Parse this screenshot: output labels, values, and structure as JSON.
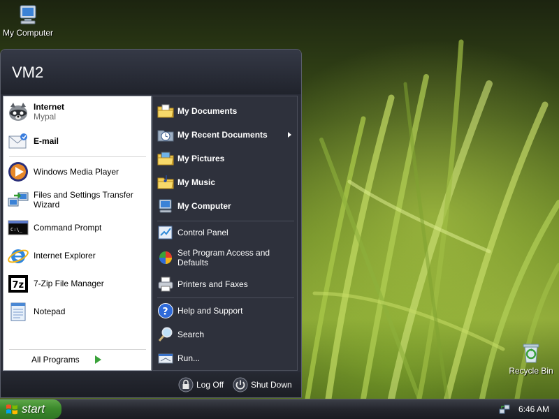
{
  "desktop": {
    "icons": [
      {
        "label": "My Computer",
        "icon": "my-computer-icon"
      },
      {
        "label": "Recycle Bin",
        "icon": "recycle-bin-icon"
      }
    ]
  },
  "start_menu": {
    "user_name": "VM2",
    "pinned": [
      {
        "title": "Internet",
        "subtitle": "Mypal",
        "icon": "raccoon-browser-icon"
      },
      {
        "title": "E-mail",
        "icon": "email-icon"
      }
    ],
    "recent": [
      {
        "label": "Windows Media Player",
        "icon": "media-player-icon"
      },
      {
        "label": "Files and Settings Transfer Wizard",
        "icon": "transfer-wizard-icon"
      },
      {
        "label": "Command Prompt",
        "icon": "command-prompt-icon"
      },
      {
        "label": "Internet Explorer",
        "icon": "internet-explorer-icon"
      },
      {
        "label": "7-Zip File Manager",
        "icon": "seven-zip-icon"
      },
      {
        "label": "Notepad",
        "icon": "notepad-icon"
      }
    ],
    "all_programs": "All Programs",
    "places": [
      {
        "label": "My Documents",
        "icon": "folder-documents-icon"
      },
      {
        "label": "My Recent Documents",
        "icon": "recent-documents-icon"
      },
      {
        "label": "My Pictures",
        "icon": "folder-pictures-icon"
      },
      {
        "label": "My Music",
        "icon": "folder-music-icon"
      },
      {
        "label": "My Computer",
        "icon": "my-computer-icon"
      }
    ],
    "settings": [
      {
        "label": "Control Panel",
        "icon": "control-panel-icon"
      },
      {
        "label": "Set Program Access and Defaults",
        "icon": "program-defaults-icon"
      },
      {
        "label": "Printers and Faxes",
        "icon": "printer-icon"
      }
    ],
    "help": [
      {
        "label": "Help and Support",
        "icon": "help-icon"
      },
      {
        "label": "Search",
        "icon": "search-icon"
      },
      {
        "label": "Run...",
        "icon": "run-icon"
      }
    ],
    "footer": {
      "log_off": "Log Off",
      "shut_down": "Shut Down"
    }
  },
  "taskbar": {
    "start_label": "start",
    "clock": "6:46 AM"
  },
  "colors": {
    "menu_dark": "#2e313c",
    "start_green": "#3c8a2c",
    "accent_arrow": "#3aa23a"
  }
}
